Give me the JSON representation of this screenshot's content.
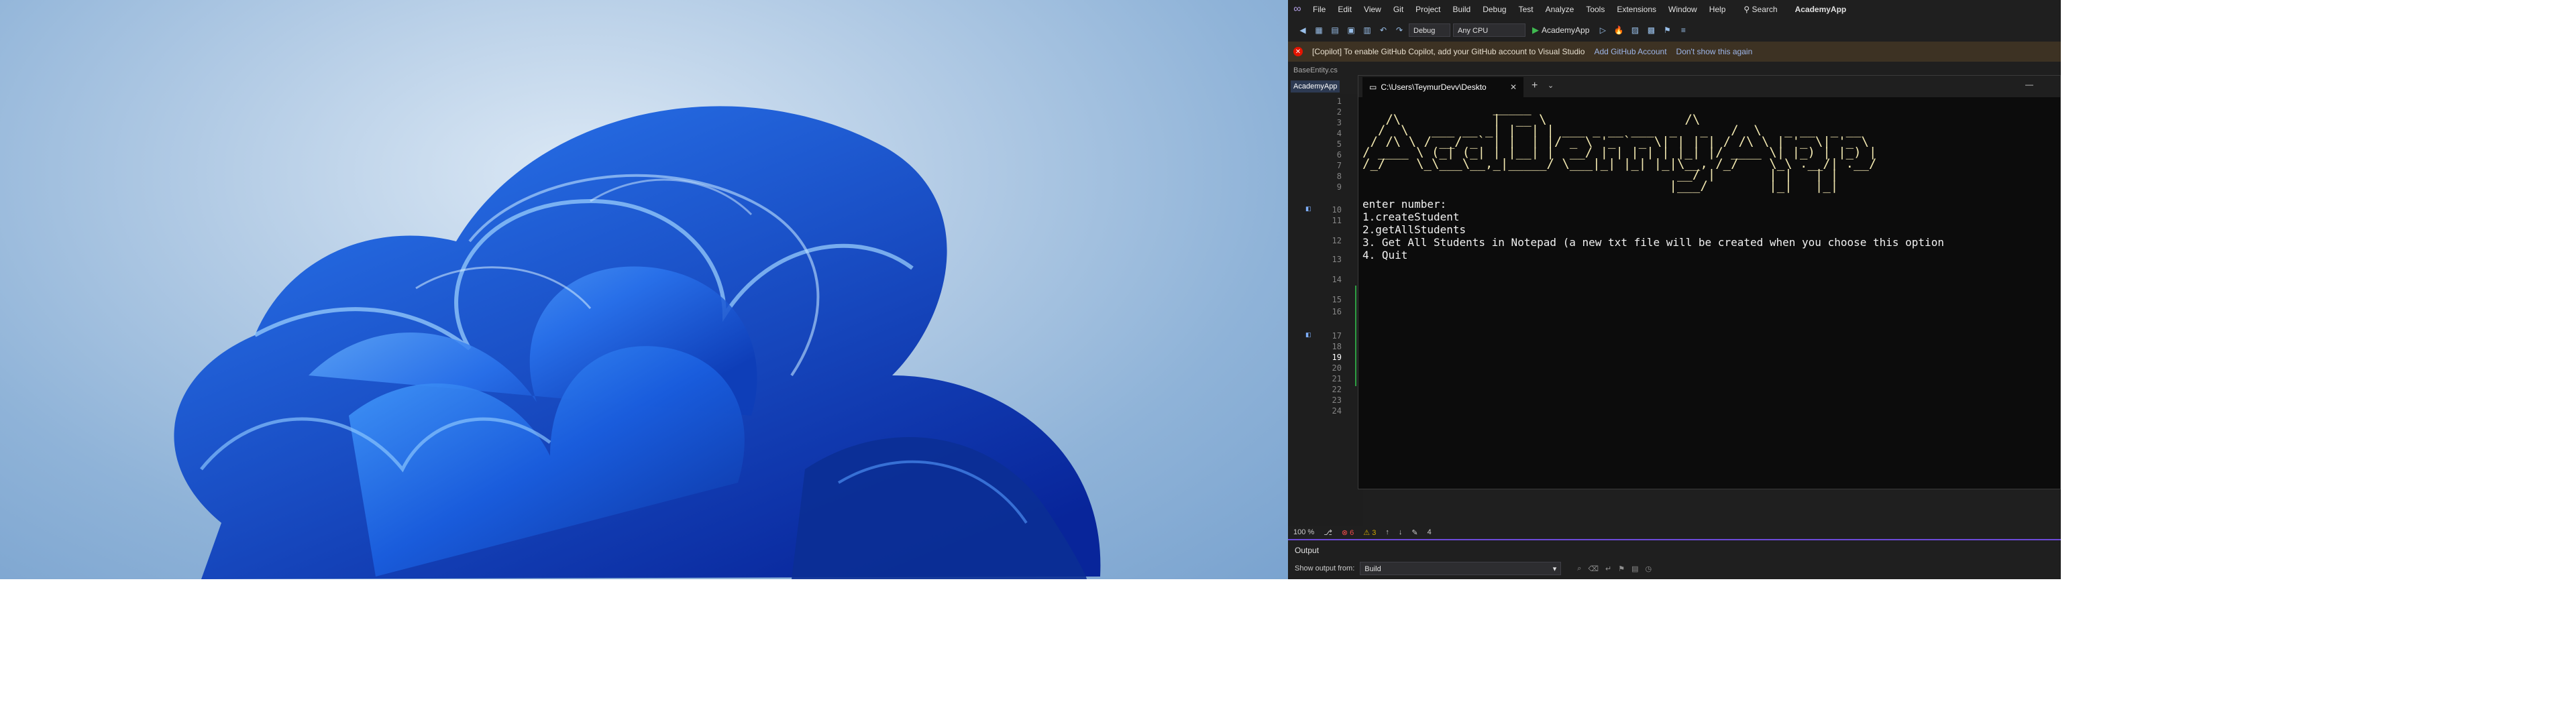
{
  "desktop": {
    "wallpaper": "windows-11-bloom"
  },
  "vs": {
    "menu": [
      "File",
      "Edit",
      "View",
      "Git",
      "Project",
      "Build",
      "Debug",
      "Test",
      "Analyze",
      "Tools",
      "Extensions",
      "Window",
      "Help"
    ],
    "search_label": "Search",
    "app_title": "AcademyApp",
    "toolbar": {
      "config": "Debug",
      "platform": "Any CPU",
      "run_label": "AcademyApp"
    },
    "infobar": {
      "message": "[Copilot] To enable GitHub Copilot, add your GitHub account to Visual Studio",
      "link_add": "Add GitHub Account",
      "link_dismiss": "Don't show this again"
    },
    "doc_tabs": {
      "tab1": "BaseEntity.cs",
      "tab2": "AcademyApp"
    },
    "line_numbers": [
      "1",
      "2",
      "3",
      "4",
      "5",
      "6",
      "7",
      "8",
      "9",
      "10",
      "11",
      "12",
      "13",
      "14",
      "15",
      "16",
      "17",
      "18",
      "19",
      "20",
      "21",
      "22",
      "23",
      "24"
    ],
    "current_line": "19",
    "terminal": {
      "tab_title": "C:\\Users\\TeymurDevv\\Deskto",
      "banner": "                 _____                         \n   /\\            |  __ \\                  /\\              \n  /  \\   ___ __ _| |  | | ___ _ __ ___  _   _   /  \\   _ __  _ __  \n / /\\ \\ / __/ _` | |  | |/ _ \\ '_ ` _ \\| | | | / /\\ \\ | '_ \\| '_ \\ \n/ ____ \\ (_| (_| | |__| |  __/ | | | | | |_| |/ ____ \\| |_) | |_) |\n/_/    \\_\\___\\__,_|_____/ \\___|_| |_| |_|\\__, /_/    \\_\\ .__/| .__/ \n                                         __/ |       | |   | |    \n                                        |___/        |_|   |_|    ",
      "lines": [
        "enter number:",
        "1.createStudent",
        "2.getAllStudents",
        "3. Get All Students in Notepad (a new txt file will be created when you choose this option",
        "4. Quit"
      ]
    },
    "status": {
      "zoom": "100 %",
      "errors": "6",
      "warnings": "3",
      "col": "4"
    },
    "output": {
      "title": "Output",
      "show_from_label": "Show output from:",
      "source": "Build"
    }
  }
}
